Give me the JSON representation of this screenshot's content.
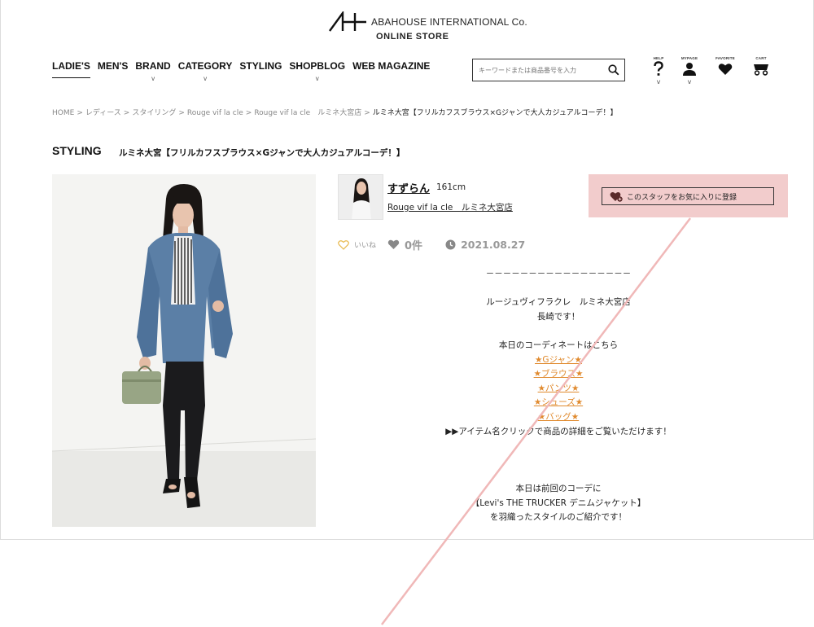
{
  "header": {
    "brand": "ABAHOUSE INTERNATIONAL Co.",
    "store": "ONLINE STORE",
    "logo_icon": "ah-logo-icon"
  },
  "nav": {
    "items": [
      {
        "label": "LADIE'S",
        "active": true,
        "dropdown": false
      },
      {
        "label": "MEN'S",
        "active": false,
        "dropdown": false
      },
      {
        "label": "BRAND",
        "active": false,
        "dropdown": true
      },
      {
        "label": "CATEGORY",
        "active": false,
        "dropdown": true
      },
      {
        "label": "STYLING",
        "active": false,
        "dropdown": false
      },
      {
        "label": "SHOPBLOG",
        "active": false,
        "dropdown": true
      },
      {
        "label": "WEB MAGAZINE",
        "active": false,
        "dropdown": false
      }
    ],
    "caret": "v"
  },
  "search": {
    "placeholder": "キーワードまたは商品番号を入力",
    "icon": "search-icon"
  },
  "utility": {
    "help": "HELP",
    "mypage": "MYPAGE",
    "favorite": "FAVORITE",
    "cart": "CART",
    "caret": "v"
  },
  "breadcrumb": {
    "items": [
      "HOME",
      "レディース",
      "スタイリング",
      "Rouge vif la cle",
      "Rouge vif la cle　ルミネ大宮店"
    ],
    "current": "ルミネ大宮【フリルカフスブラウス×Gジャンで大人カジュアルコーデ！】",
    "separator": ">"
  },
  "page": {
    "label": "STYLING",
    "title": "ルミネ大宮【フリルカフスブラウス×Gジャンで大人カジュアルコーデ！】"
  },
  "staff": {
    "name": "すずらん",
    "height": "161cm",
    "shop": "Rouge vif la cle　ルミネ大宮店",
    "favorite_button": "このスタッフをお気に入りに登録"
  },
  "meta": {
    "like_label": "いいね",
    "count": "0件",
    "date": "2021.08.27"
  },
  "body": {
    "divider": "－－－－－－－－－－－－－－－－－",
    "intro_1": "ルージュヴィフラクレ　ルミネ大宮店",
    "intro_2": "長崎です！",
    "coord_heading": "本日のコーディネートはこちら",
    "links": [
      "★Gジャン★",
      "★ブラウス★",
      "★パンツ★",
      "★シューズ★",
      "★バッグ★"
    ],
    "hint": "▶▶アイテム名クリックで商品の詳細をご覧いただけます！",
    "para_1": "本日は前回のコーデに",
    "para_2": "【Levi's THE TRUCKER デニムジャケット】",
    "para_3": "を羽織ったスタイルのご紹介です！"
  },
  "colors": {
    "accent_pink": "#f2cccc",
    "link_orange": "#e08a2e",
    "like_heart": "#e8b84a",
    "diagonal_line": "#f0b8b8"
  }
}
